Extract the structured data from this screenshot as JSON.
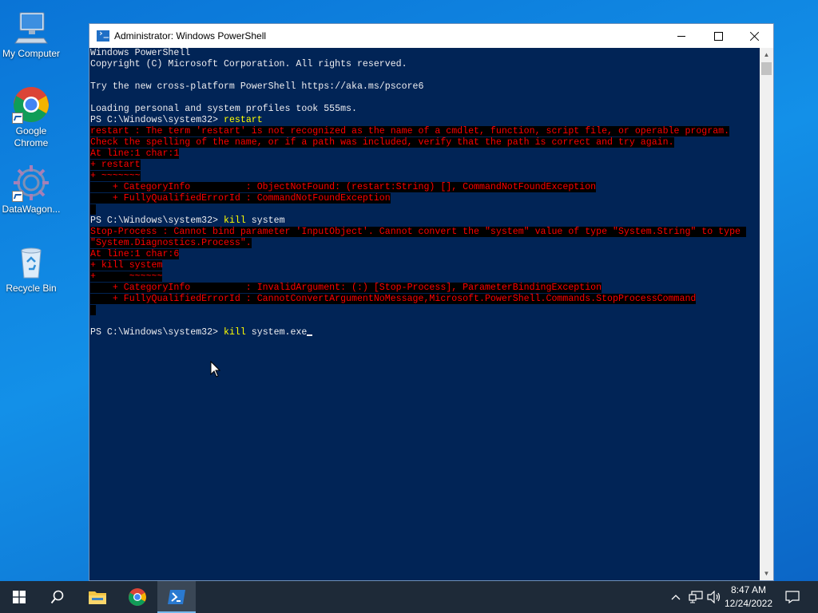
{
  "desktop": {
    "icons": [
      {
        "label": "My Computer"
      },
      {
        "label": "Google Chrome"
      },
      {
        "label": "DataWagon..."
      },
      {
        "label": "Recycle Bin"
      }
    ]
  },
  "window": {
    "title": "Administrator: Windows PowerShell",
    "controls": {
      "minimize": "minimize",
      "maximize": "maximize",
      "close": "close"
    }
  },
  "console": {
    "lines": [
      {
        "text": "Windows PowerShell",
        "type": "out"
      },
      {
        "text": "Copyright (C) Microsoft Corporation. All rights reserved.",
        "type": "out"
      },
      {
        "text": "",
        "type": "out"
      },
      {
        "text": "Try the new cross-platform PowerShell https://aka.ms/pscore6",
        "type": "out"
      },
      {
        "text": "",
        "type": "out"
      },
      {
        "text": "Loading personal and system profiles took 555ms.",
        "type": "out"
      },
      {
        "prompt": "PS C:\\Windows\\system32> ",
        "cmd": "restart",
        "args": "",
        "type": "prompt"
      },
      {
        "text": "restart : The term 'restart' is not recognized as the name of a cmdlet, function, script file, or operable program.",
        "type": "err"
      },
      {
        "text": "Check the spelling of the name, or if a path was included, verify that the path is correct and try again.",
        "type": "err"
      },
      {
        "text": "At line:1 char:1",
        "type": "err"
      },
      {
        "text": "+ restart",
        "type": "err"
      },
      {
        "text": "+ ~~~~~~~",
        "type": "err"
      },
      {
        "text": "    + CategoryInfo          : ObjectNotFound: (restart:String) [], CommandNotFoundException",
        "type": "err"
      },
      {
        "text": "    + FullyQualifiedErrorId : CommandNotFoundException",
        "type": "err"
      },
      {
        "text": " ",
        "type": "err"
      },
      {
        "prompt": "PS C:\\Windows\\system32> ",
        "cmd": "kill",
        "args": " system",
        "type": "prompt"
      },
      {
        "text": "Stop-Process : Cannot bind parameter 'InputObject'. Cannot convert the \"system\" value of type \"System.String\" to type ",
        "type": "err"
      },
      {
        "text": "\"System.Diagnostics.Process\".",
        "type": "err"
      },
      {
        "text": "At line:1 char:6",
        "type": "err"
      },
      {
        "text": "+ kill system",
        "type": "err"
      },
      {
        "text": "+      ~~~~~~",
        "type": "err"
      },
      {
        "text": "    + CategoryInfo          : InvalidArgument: (:) [Stop-Process], ParameterBindingException",
        "type": "err"
      },
      {
        "text": "    + FullyQualifiedErrorId : CannotConvertArgumentNoMessage,Microsoft.PowerShell.Commands.StopProcessCommand",
        "type": "err"
      },
      {
        "text": " ",
        "type": "err"
      },
      {
        "text": "",
        "type": "out"
      },
      {
        "prompt": "PS C:\\Windows\\system32> ",
        "cmd": "kill",
        "args": " system.exe",
        "type": "prompt",
        "cursor": true
      }
    ]
  },
  "taskbar": {
    "items": [
      {
        "name": "start-button",
        "icon": "windows-logo-icon"
      },
      {
        "name": "search-button",
        "icon": "search-icon"
      },
      {
        "name": "file-explorer-button",
        "icon": "folder-icon"
      },
      {
        "name": "chrome-button",
        "icon": "chrome-icon"
      },
      {
        "name": "powershell-button",
        "icon": "powershell-icon"
      }
    ],
    "clock": {
      "time": "8:47 AM",
      "date": "12/24/2022"
    }
  },
  "colors": {
    "console_bg": "#012456",
    "error_fg": "#ff0000",
    "command_fg": "#ffff00",
    "taskbar_bg": "#1e2a38"
  }
}
